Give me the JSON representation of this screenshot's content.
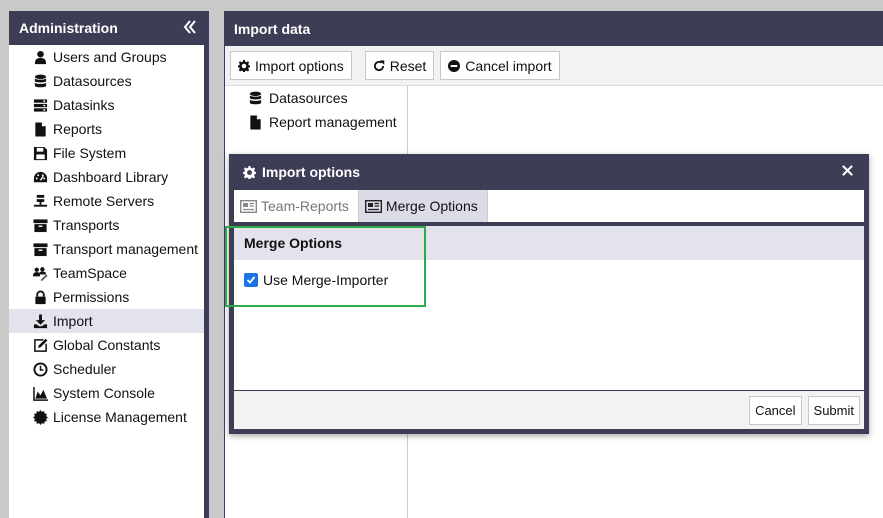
{
  "sidebar": {
    "title": "Administration",
    "collapse_icon": "double-chevron-left-icon",
    "items": [
      {
        "label": "Users and Groups",
        "icon": "user-icon"
      },
      {
        "label": "Datasources",
        "icon": "database-icon"
      },
      {
        "label": "Datasinks",
        "icon": "server-icon"
      },
      {
        "label": "Reports",
        "icon": "file-icon"
      },
      {
        "label": "File System",
        "icon": "floppy-icon"
      },
      {
        "label": "Dashboard Library",
        "icon": "dashboard-icon"
      },
      {
        "label": "Remote Servers",
        "icon": "remote-server-icon"
      },
      {
        "label": "Transports",
        "icon": "archive-icon"
      },
      {
        "label": "Transport management",
        "icon": "archive-icon"
      },
      {
        "label": "TeamSpace",
        "icon": "team-icon"
      },
      {
        "label": "Permissions",
        "icon": "lock-icon"
      },
      {
        "label": "Import",
        "icon": "download-icon",
        "active": true
      },
      {
        "label": "Global Constants",
        "icon": "edit-icon"
      },
      {
        "label": "Scheduler",
        "icon": "clock-icon"
      },
      {
        "label": "System Console",
        "icon": "area-chart-icon"
      },
      {
        "label": "License Management",
        "icon": "certificate-icon"
      }
    ]
  },
  "main": {
    "title": "Import data",
    "toolbar": {
      "import_options_label": "Import options",
      "reset_label": "Reset",
      "cancel_import_label": "Cancel import"
    },
    "tree": [
      {
        "label": "Datasources",
        "icon": "database-icon"
      },
      {
        "label": "Report management",
        "icon": "file-icon"
      }
    ]
  },
  "dialog": {
    "title": "Import options",
    "tabs": [
      {
        "label": "Team-Reports",
        "active": false
      },
      {
        "label": "Merge Options",
        "active": true
      }
    ],
    "section_title": "Merge Options",
    "checkbox_label": "Use Merge-Importer",
    "checkbox_checked": true,
    "cancel_label": "Cancel",
    "submit_label": "Submit"
  },
  "colors": {
    "header_bg": "#3d3d56",
    "active_item_bg": "#e3e3ee",
    "highlight_border": "#2eaa4a",
    "checkbox_blue": "#1a73e8"
  }
}
